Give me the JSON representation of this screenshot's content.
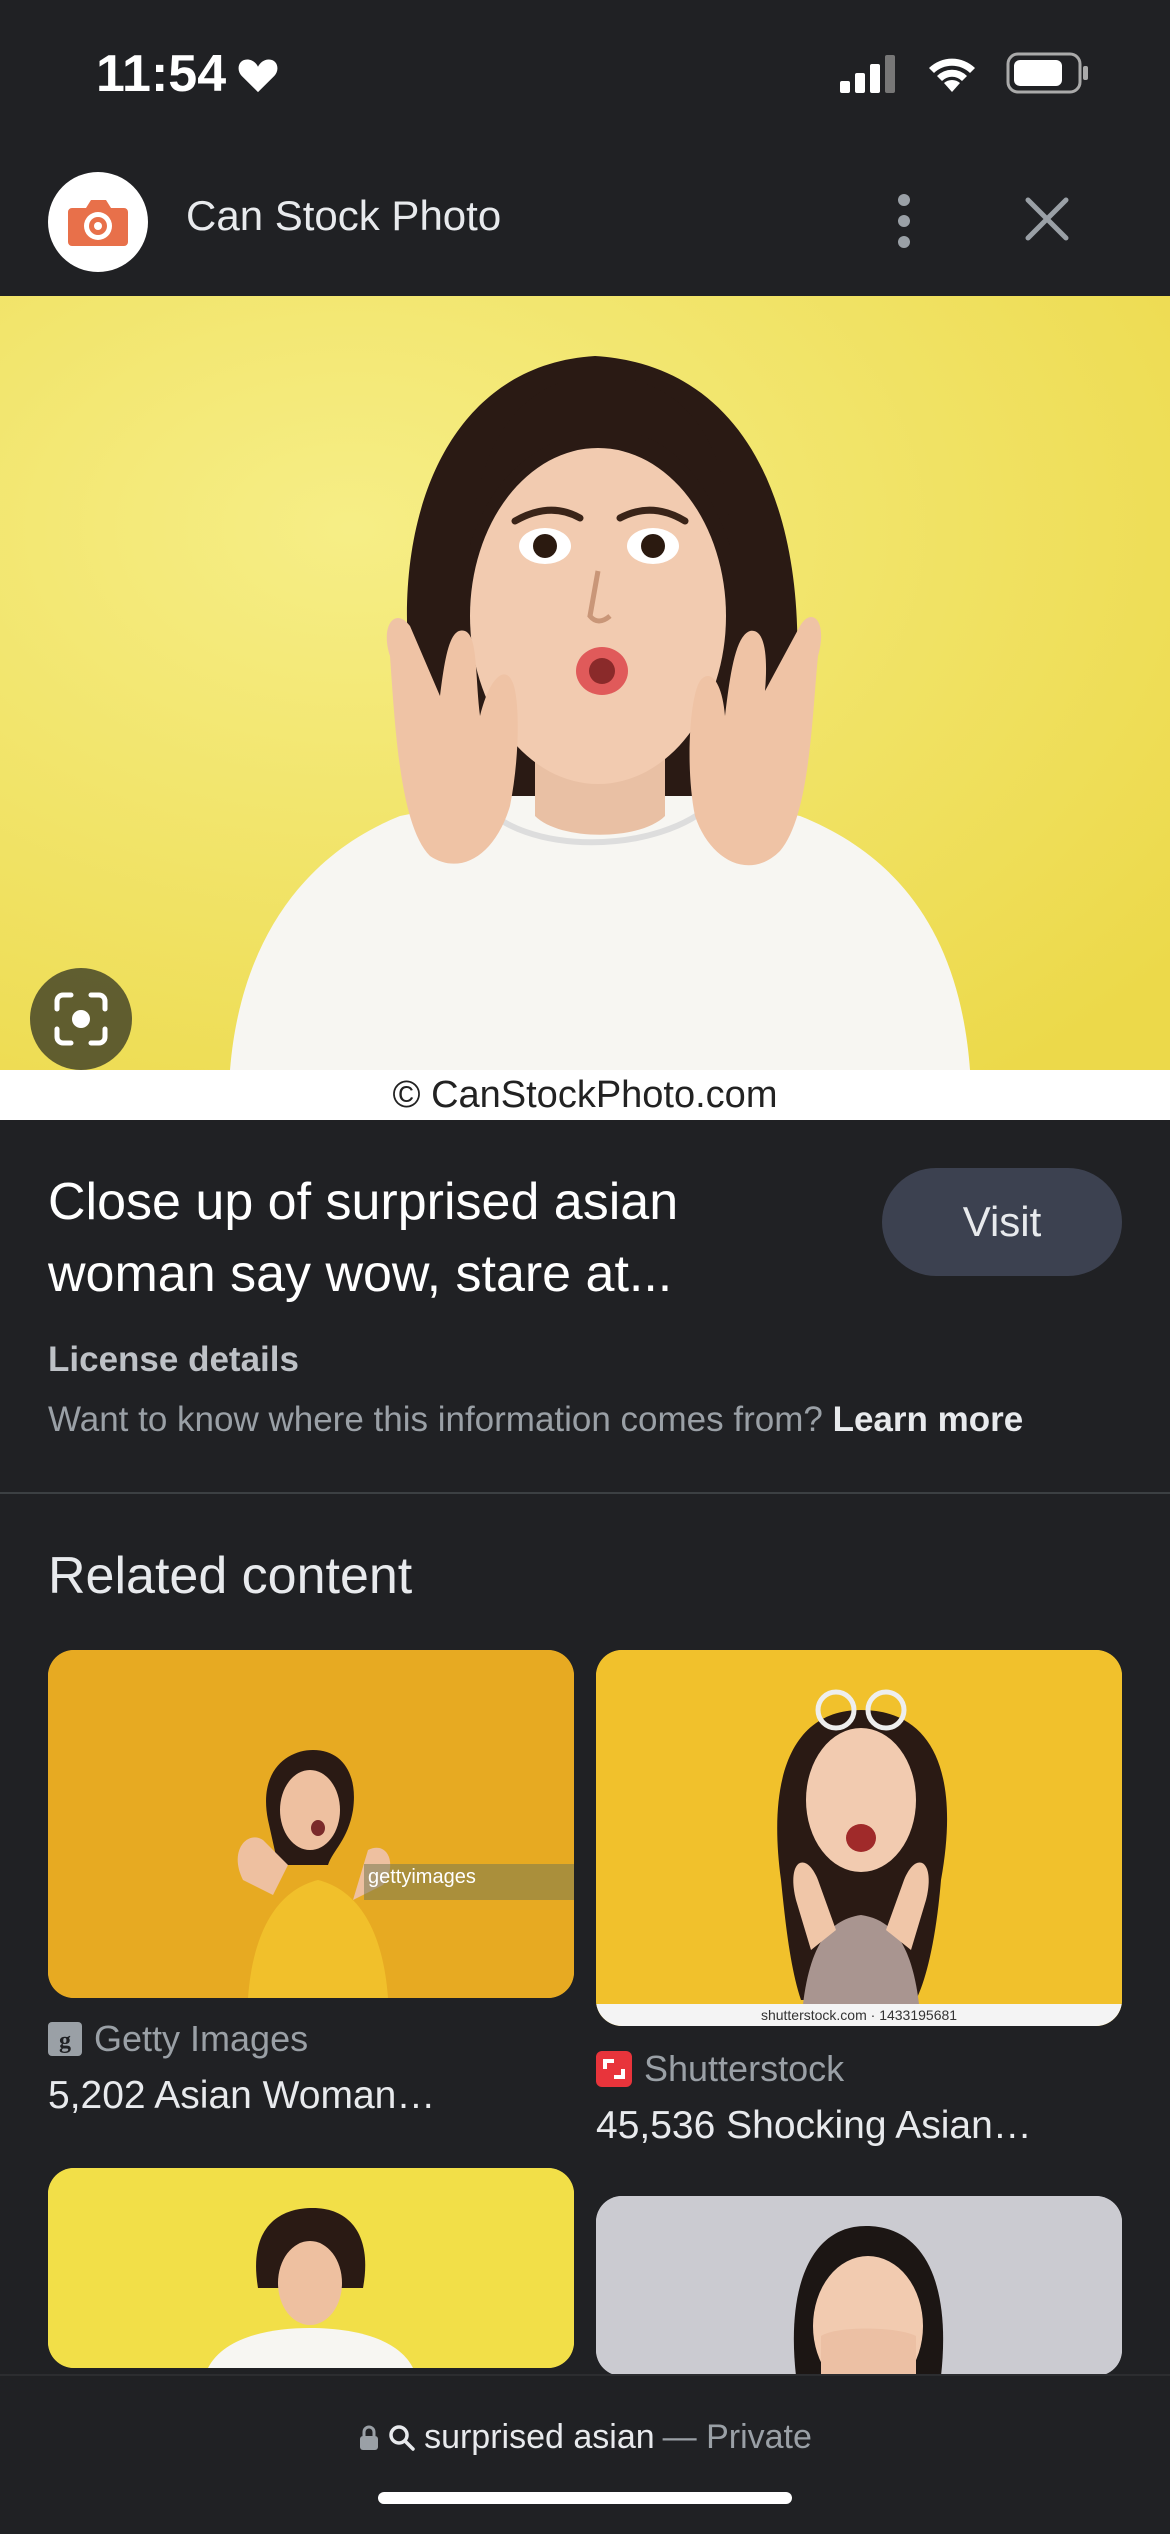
{
  "status": {
    "time": "11:54"
  },
  "header": {
    "site_name": "Can Stock Photo"
  },
  "hero": {
    "caption": "© CanStockPhoto.com"
  },
  "result": {
    "title": "Close up of surprised asian woman say wow, stare at...",
    "visit_label": "Visit",
    "license_label": "License details",
    "info_text": "Want to know where this information comes from?",
    "learn_more": "Learn more"
  },
  "related": {
    "heading": "Related content",
    "items": [
      {
        "source": "Getty Images",
        "title": "5,202 Asian Woman…",
        "watermark": "gettyimages"
      },
      {
        "source": "Shutterstock",
        "title": "45,536 Shocking Asian…",
        "watermark": "shutterstock.com · 1433195681"
      }
    ]
  },
  "bottom": {
    "query": "surprised asian",
    "mode": "— Private"
  },
  "colors": {
    "background": "#202124",
    "hero_bg": "#f3e664",
    "visit_bg": "#3c4150",
    "site_icon": "#e8704a"
  }
}
